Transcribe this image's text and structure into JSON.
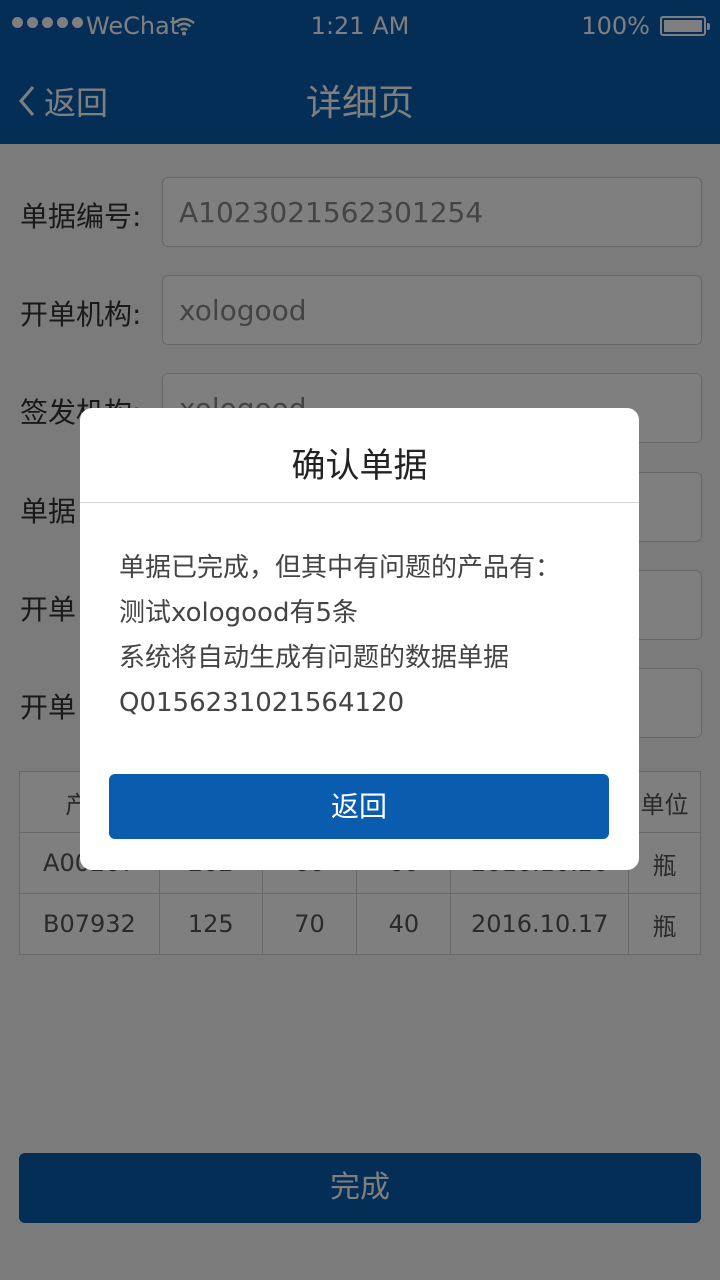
{
  "status_bar": {
    "carrier": "WeChat",
    "time": "1:21 AM",
    "battery": "100%"
  },
  "nav": {
    "back_label": "返回",
    "title": "详细页"
  },
  "form": {
    "fields": [
      {
        "label": "单据编号:",
        "value": "A1023021562301254"
      },
      {
        "label": "开单机构:",
        "value": "xologood"
      },
      {
        "label": "签发机构:",
        "value": "xologood"
      },
      {
        "label": "单据",
        "value": ""
      },
      {
        "label": "开单",
        "value": ""
      },
      {
        "label": "开单",
        "value": ""
      }
    ]
  },
  "table": {
    "headers": [
      "产品",
      "",
      "",
      "",
      "",
      "单位"
    ],
    "rows": [
      [
        "A00207",
        "202",
        "60",
        "60",
        "2016.10.20",
        "瓶"
      ],
      [
        "B07932",
        "125",
        "70",
        "40",
        "2016.10.17",
        "瓶"
      ]
    ]
  },
  "done_label": "完成",
  "dialog": {
    "title": "确认单据",
    "lines": [
      "单据已完成，但其中有问题的产品有：",
      "测试xologood有5条",
      "系统将自动生成有问题的数据单据",
      "Q0156231021564120"
    ],
    "button_label": "返回"
  },
  "colors": {
    "brand": "#0a5caf",
    "overlay": "rgba(0,0,0,0.5)"
  }
}
